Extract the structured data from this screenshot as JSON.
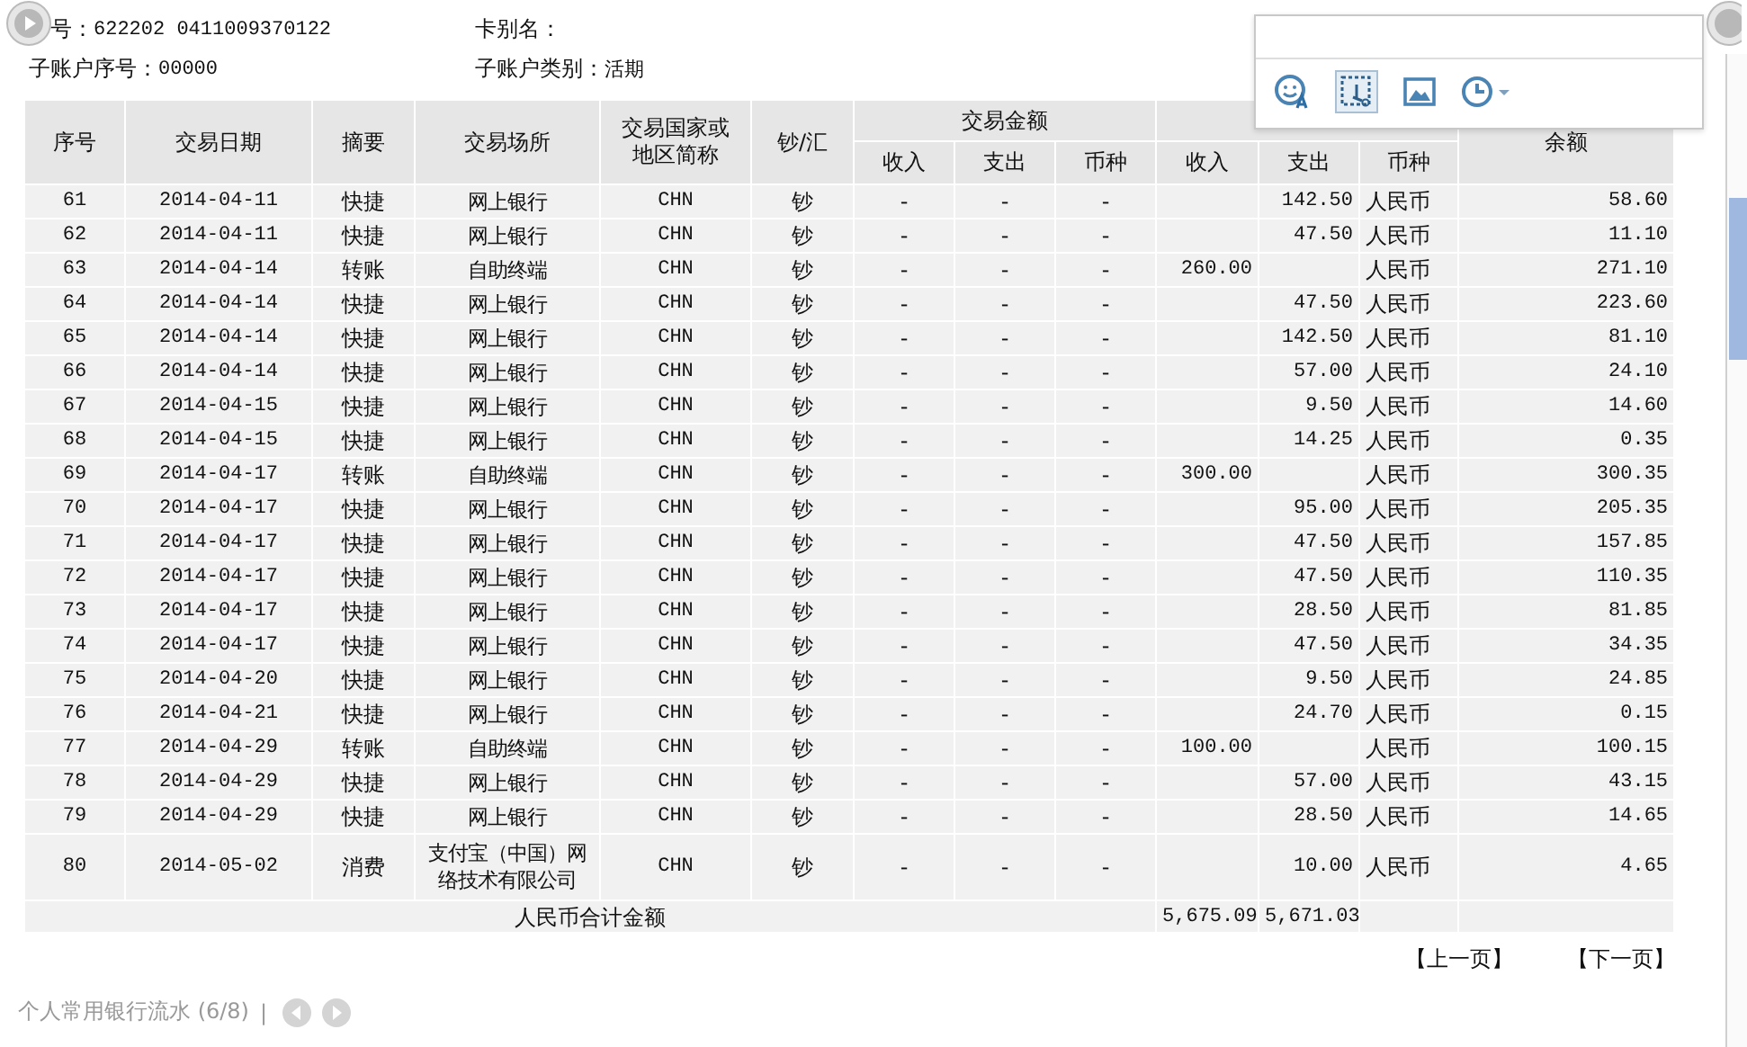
{
  "account_info": [
    {
      "label": "号：",
      "value": "622202 0411009370122"
    },
    {
      "label": "卡别名："
    },
    {
      "label": "子账户序号：",
      "value": "00000"
    },
    {
      "label": "子账户类别：",
      "value": "活期"
    }
  ],
  "table": {
    "columns": [
      "序号",
      "交易日期",
      "摘要",
      "交易场所",
      "交易国家或地区简称",
      "钞/汇"
    ],
    "group_columns": [
      {
        "label": "交易金额",
        "sub": [
          "收入",
          "支出",
          "币种"
        ]
      },
      {
        "sub": [
          "收入",
          "支出",
          "币种"
        ]
      }
    ],
    "last_column": "余额",
    "rows": [
      {
        "seq": "61",
        "date": "2014-04-11",
        "summary": "快捷",
        "place": "网上银行",
        "region": "CHN",
        "cash_remit": "钞",
        "txn_in": "-",
        "txn_out": "-",
        "txn_currency": "-",
        "book_out": "142.50",
        "book_currency": "人民币",
        "balance": "58.60"
      },
      {
        "seq": "62",
        "date": "2014-04-11",
        "summary": "快捷",
        "place": "网上银行",
        "region": "CHN",
        "cash_remit": "钞",
        "txn_in": "-",
        "txn_out": "-",
        "txn_currency": "-",
        "book_out": "47.50",
        "book_currency": "人民币",
        "balance": "11.10"
      },
      {
        "seq": "63",
        "date": "2014-04-14",
        "summary": "转账",
        "place": "自助终端",
        "region": "CHN",
        "cash_remit": "钞",
        "txn_in": "-",
        "txn_out": "-",
        "txn_currency": "-",
        "book_in": "260.00",
        "book_currency": "人民币",
        "balance": "271.10"
      },
      {
        "seq": "64",
        "date": "2014-04-14",
        "summary": "快捷",
        "place": "网上银行",
        "region": "CHN",
        "cash_remit": "钞",
        "txn_in": "-",
        "txn_out": "-",
        "txn_currency": "-",
        "book_out": "47.50",
        "book_currency": "人民币",
        "balance": "223.60"
      },
      {
        "seq": "65",
        "date": "2014-04-14",
        "summary": "快捷",
        "place": "网上银行",
        "region": "CHN",
        "cash_remit": "钞",
        "txn_in": "-",
        "txn_out": "-",
        "txn_currency": "-",
        "book_out": "142.50",
        "book_currency": "人民币",
        "balance": "81.10"
      },
      {
        "seq": "66",
        "date": "2014-04-14",
        "summary": "快捷",
        "place": "网上银行",
        "region": "CHN",
        "cash_remit": "钞",
        "txn_in": "-",
        "txn_out": "-",
        "txn_currency": "-",
        "book_out": "57.00",
        "book_currency": "人民币",
        "balance": "24.10"
      },
      {
        "seq": "67",
        "date": "2014-04-15",
        "summary": "快捷",
        "place": "网上银行",
        "region": "CHN",
        "cash_remit": "钞",
        "txn_in": "-",
        "txn_out": "-",
        "txn_currency": "-",
        "book_out": "9.50",
        "book_currency": "人民币",
        "balance": "14.60"
      },
      {
        "seq": "68",
        "date": "2014-04-15",
        "summary": "快捷",
        "place": "网上银行",
        "region": "CHN",
        "cash_remit": "钞",
        "txn_in": "-",
        "txn_out": "-",
        "txn_currency": "-",
        "book_out": "14.25",
        "book_currency": "人民币",
        "balance": "0.35"
      },
      {
        "seq": "69",
        "date": "2014-04-17",
        "summary": "转账",
        "place": "自助终端",
        "region": "CHN",
        "cash_remit": "钞",
        "txn_in": "-",
        "txn_out": "-",
        "txn_currency": "-",
        "book_in": "300.00",
        "book_currency": "人民币",
        "balance": "300.35"
      },
      {
        "seq": "70",
        "date": "2014-04-17",
        "summary": "快捷",
        "place": "网上银行",
        "region": "CHN",
        "cash_remit": "钞",
        "txn_in": "-",
        "txn_out": "-",
        "txn_currency": "-",
        "book_out": "95.00",
        "book_currency": "人民币",
        "balance": "205.35"
      },
      {
        "seq": "71",
        "date": "2014-04-17",
        "summary": "快捷",
        "place": "网上银行",
        "region": "CHN",
        "cash_remit": "钞",
        "txn_in": "-",
        "txn_out": "-",
        "txn_currency": "-",
        "book_out": "47.50",
        "book_currency": "人民币",
        "balance": "157.85"
      },
      {
        "seq": "72",
        "date": "2014-04-17",
        "summary": "快捷",
        "place": "网上银行",
        "region": "CHN",
        "cash_remit": "钞",
        "txn_in": "-",
        "txn_out": "-",
        "txn_currency": "-",
        "book_out": "47.50",
        "book_currency": "人民币",
        "balance": "110.35"
      },
      {
        "seq": "73",
        "date": "2014-04-17",
        "summary": "快捷",
        "place": "网上银行",
        "region": "CHN",
        "cash_remit": "钞",
        "txn_in": "-",
        "txn_out": "-",
        "txn_currency": "-",
        "book_out": "28.50",
        "book_currency": "人民币",
        "balance": "81.85"
      },
      {
        "seq": "74",
        "date": "2014-04-17",
        "summary": "快捷",
        "place": "网上银行",
        "region": "CHN",
        "cash_remit": "钞",
        "txn_in": "-",
        "txn_out": "-",
        "txn_currency": "-",
        "book_out": "47.50",
        "book_currency": "人民币",
        "balance": "34.35"
      },
      {
        "seq": "75",
        "date": "2014-04-20",
        "summary": "快捷",
        "place": "网上银行",
        "region": "CHN",
        "cash_remit": "钞",
        "txn_in": "-",
        "txn_out": "-",
        "txn_currency": "-",
        "book_out": "9.50",
        "book_currency": "人民币",
        "balance": "24.85"
      },
      {
        "seq": "76",
        "date": "2014-04-21",
        "summary": "快捷",
        "place": "网上银行",
        "region": "CHN",
        "cash_remit": "钞",
        "txn_in": "-",
        "txn_out": "-",
        "txn_currency": "-",
        "book_out": "24.70",
        "book_currency": "人民币",
        "balance": "0.15"
      },
      {
        "seq": "77",
        "date": "2014-04-29",
        "summary": "转账",
        "place": "自助终端",
        "region": "CHN",
        "cash_remit": "钞",
        "txn_in": "-",
        "txn_out": "-",
        "txn_currency": "-",
        "book_in": "100.00",
        "book_currency": "人民币",
        "balance": "100.15"
      },
      {
        "seq": "78",
        "date": "2014-04-29",
        "summary": "快捷",
        "place": "网上银行",
        "region": "CHN",
        "cash_remit": "钞",
        "txn_in": "-",
        "txn_out": "-",
        "txn_currency": "-",
        "book_out": "57.00",
        "book_currency": "人民币",
        "balance": "43.15"
      },
      {
        "seq": "79",
        "date": "2014-04-29",
        "summary": "快捷",
        "place": "网上银行",
        "region": "CHN",
        "cash_remit": "钞",
        "txn_in": "-",
        "txn_out": "-",
        "txn_currency": "-",
        "book_out": "28.50",
        "book_currency": "人民币",
        "balance": "14.65"
      },
      {
        "seq": "80",
        "date": "2014-05-02",
        "summary": "消费",
        "place": "支付宝（中国）网络技术有限公司",
        "region": "CHN",
        "cash_remit": "钞",
        "txn_in": "-",
        "txn_out": "-",
        "txn_currency": "-",
        "book_out": "10.00",
        "book_currency": "人民币",
        "balance": "4.65"
      }
    ],
    "total": {
      "label": "人民币合计金额",
      "book_in": "5,675.09",
      "book_out": "5,671.03"
    }
  },
  "pager": [
    "【上一页】",
    "【下一页】"
  ],
  "footer": {
    "title": "个人常用银行流水 (6/8)",
    "separator": "|"
  }
}
